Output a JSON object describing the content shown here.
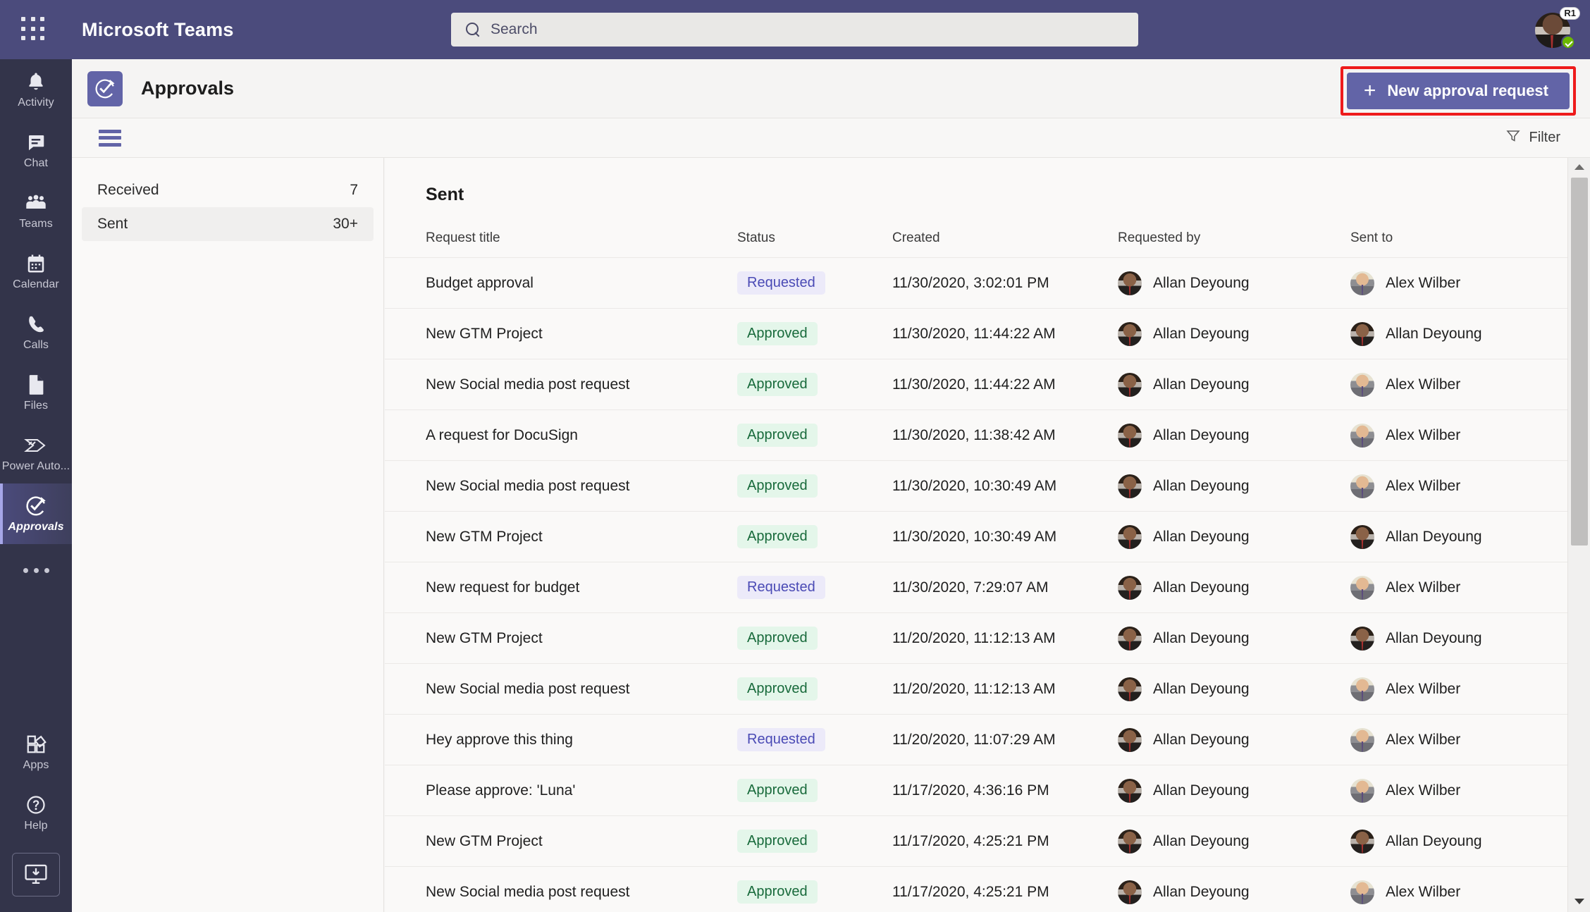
{
  "topbar": {
    "app_title": "Microsoft Teams",
    "waffle_icon": "grid-waffle-icon",
    "search": {
      "placeholder": "Search",
      "value": "",
      "icon": "search-icon"
    },
    "avatar": {
      "name": "avatar",
      "badge": "R1",
      "presence": "available"
    }
  },
  "rail": {
    "items": [
      {
        "label": "Activity",
        "icon": "bell-icon",
        "active": false
      },
      {
        "label": "Chat",
        "icon": "chat-icon",
        "active": false
      },
      {
        "label": "Teams",
        "icon": "people-icon",
        "active": false
      },
      {
        "label": "Calendar",
        "icon": "calendar-icon",
        "active": false
      },
      {
        "label": "Calls",
        "icon": "phone-icon",
        "active": false
      },
      {
        "label": "Files",
        "icon": "file-icon",
        "active": false
      },
      {
        "label": "Power Auto...",
        "icon": "power-automate-icon",
        "active": false
      },
      {
        "label": "Approvals",
        "icon": "approvals-check-icon",
        "active": true
      }
    ],
    "more_icon": "ellipsis-icon",
    "bottom": [
      {
        "label": "Apps",
        "icon": "apps-icon"
      },
      {
        "label": "Help",
        "icon": "help-circle-icon"
      }
    ],
    "get_app_icon": "download-desktop-icon"
  },
  "app_header": {
    "icon": "approvals-app-icon",
    "title": "Approvals",
    "new_request_label": "New approval request",
    "new_request_plus": "+",
    "highlight_color": "#ee1b1b",
    "accent_color": "#6264a7"
  },
  "toolbar": {
    "menu_icon": "hamburger-menu-icon",
    "filter_label": "Filter",
    "filter_icon": "funnel-icon"
  },
  "list_panel": {
    "items": [
      {
        "label": "Received",
        "count": "7",
        "selected": false
      },
      {
        "label": "Sent",
        "count": "30+",
        "selected": true
      }
    ]
  },
  "table": {
    "heading": "Sent",
    "columns": [
      "Request title",
      "Status",
      "Created",
      "Requested by",
      "Sent to"
    ],
    "rows": [
      {
        "title": "Budget approval",
        "status": "Requested",
        "created": "11/30/2020, 3:02:01 PM",
        "requested_by": "Allan Deyoung",
        "sent_to": "Alex Wilber"
      },
      {
        "title": "New GTM Project",
        "status": "Approved",
        "created": "11/30/2020, 11:44:22 AM",
        "requested_by": "Allan Deyoung",
        "sent_to": "Allan Deyoung"
      },
      {
        "title": "New Social media post request",
        "status": "Approved",
        "created": "11/30/2020, 11:44:22 AM",
        "requested_by": "Allan Deyoung",
        "sent_to": "Alex Wilber"
      },
      {
        "title": "A request for DocuSign",
        "status": "Approved",
        "created": "11/30/2020, 11:38:42 AM",
        "requested_by": "Allan Deyoung",
        "sent_to": "Alex Wilber"
      },
      {
        "title": "New Social media post request",
        "status": "Approved",
        "created": "11/30/2020, 10:30:49 AM",
        "requested_by": "Allan Deyoung",
        "sent_to": "Alex Wilber"
      },
      {
        "title": "New GTM Project",
        "status": "Approved",
        "created": "11/30/2020, 10:30:49 AM",
        "requested_by": "Allan Deyoung",
        "sent_to": "Allan Deyoung"
      },
      {
        "title": "New request for budget",
        "status": "Requested",
        "created": "11/30/2020, 7:29:07 AM",
        "requested_by": "Allan Deyoung",
        "sent_to": "Alex Wilber"
      },
      {
        "title": "New GTM Project",
        "status": "Approved",
        "created": "11/20/2020, 11:12:13 AM",
        "requested_by": "Allan Deyoung",
        "sent_to": "Allan Deyoung"
      },
      {
        "title": "New Social media post request",
        "status": "Approved",
        "created": "11/20/2020, 11:12:13 AM",
        "requested_by": "Allan Deyoung",
        "sent_to": "Alex Wilber"
      },
      {
        "title": "Hey approve this thing",
        "status": "Requested",
        "created": "11/20/2020, 11:07:29 AM",
        "requested_by": "Allan Deyoung",
        "sent_to": "Alex Wilber"
      },
      {
        "title": "Please approve: 'Luna'",
        "status": "Approved",
        "created": "11/17/2020, 4:36:16 PM",
        "requested_by": "Allan Deyoung",
        "sent_to": "Alex Wilber"
      },
      {
        "title": "New GTM Project",
        "status": "Approved",
        "created": "11/17/2020, 4:25:21 PM",
        "requested_by": "Allan Deyoung",
        "sent_to": "Allan Deyoung"
      },
      {
        "title": "New Social media post request",
        "status": "Approved",
        "created": "11/17/2020, 4:25:21 PM",
        "requested_by": "Allan Deyoung",
        "sent_to": "Alex Wilber"
      }
    ],
    "status_colors": {
      "Approved": "#186a3b",
      "Requested": "#4a4ab5"
    }
  },
  "scrollbar": {
    "up_icon": "scroll-up-arrow-icon",
    "down_icon": "scroll-down-arrow-icon"
  }
}
